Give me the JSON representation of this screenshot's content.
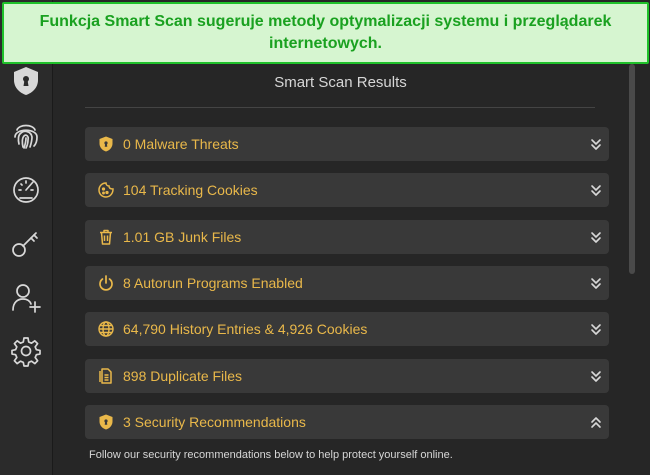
{
  "banner": {
    "text": "Funkcja Smart Scan sugeruje metody optymalizacji systemu i przeglądarek internetowych."
  },
  "sidebar": {
    "items": [
      {
        "icon": "shield-icon"
      },
      {
        "icon": "fingerprint-icon"
      },
      {
        "icon": "speedometer-icon"
      },
      {
        "icon": "key-icon"
      },
      {
        "icon": "add-user-icon"
      },
      {
        "icon": "gear-icon"
      }
    ]
  },
  "main": {
    "title": "Smart Scan Results",
    "results": [
      {
        "label": "0 Malware Threats",
        "icon": "shield-icon",
        "expanded": false
      },
      {
        "label": "104 Tracking Cookies",
        "icon": "cookie-icon",
        "expanded": false
      },
      {
        "label": "1.01 GB Junk Files",
        "icon": "trash-icon",
        "expanded": false
      },
      {
        "label": "8 Autorun Programs Enabled",
        "icon": "power-icon",
        "expanded": false
      },
      {
        "label": "64,790 History Entries & 4,926 Cookies",
        "icon": "globe-icon",
        "expanded": false
      },
      {
        "label": "898 Duplicate Files",
        "icon": "file-icon",
        "expanded": false
      },
      {
        "label": "3 Security Recommendations",
        "icon": "shield-icon",
        "expanded": true
      }
    ],
    "note": "Follow our security recommendations below to help protect yourself online."
  },
  "colors": {
    "accent": "#e9b84a",
    "banner_bg": "#d6f5d0",
    "banner_border": "#1fc12a",
    "banner_text": "#1aa120"
  }
}
